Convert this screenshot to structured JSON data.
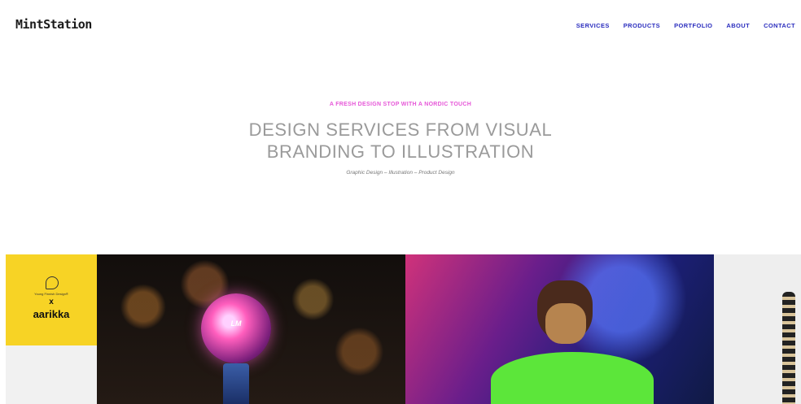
{
  "header": {
    "logo": "MintStation",
    "nav": [
      "SERVICES",
      "PRODUCTS",
      "PORTFOLIO",
      "ABOUT",
      "CONTACT"
    ]
  },
  "hero": {
    "kicker": "A FRESH DESIGN STOP WITH A NORDIC TOUCH",
    "headline_line1": "DESIGN SERVICES FROM VISUAL",
    "headline_line2": "BRANDING TO ILLUSTRATION",
    "subline": "Graphic Design – Illustration – Product Design"
  },
  "gallery": {
    "tile1": {
      "small_text": "Young Finnish Design®",
      "x": "x",
      "brand": "aarikka"
    },
    "tile2": {
      "globe_text": "LM"
    }
  },
  "colors": {
    "nav": "#2a2dbe",
    "kicker": "#e657d8",
    "headline": "#9a9a9a",
    "yellow": "#f7d325"
  }
}
